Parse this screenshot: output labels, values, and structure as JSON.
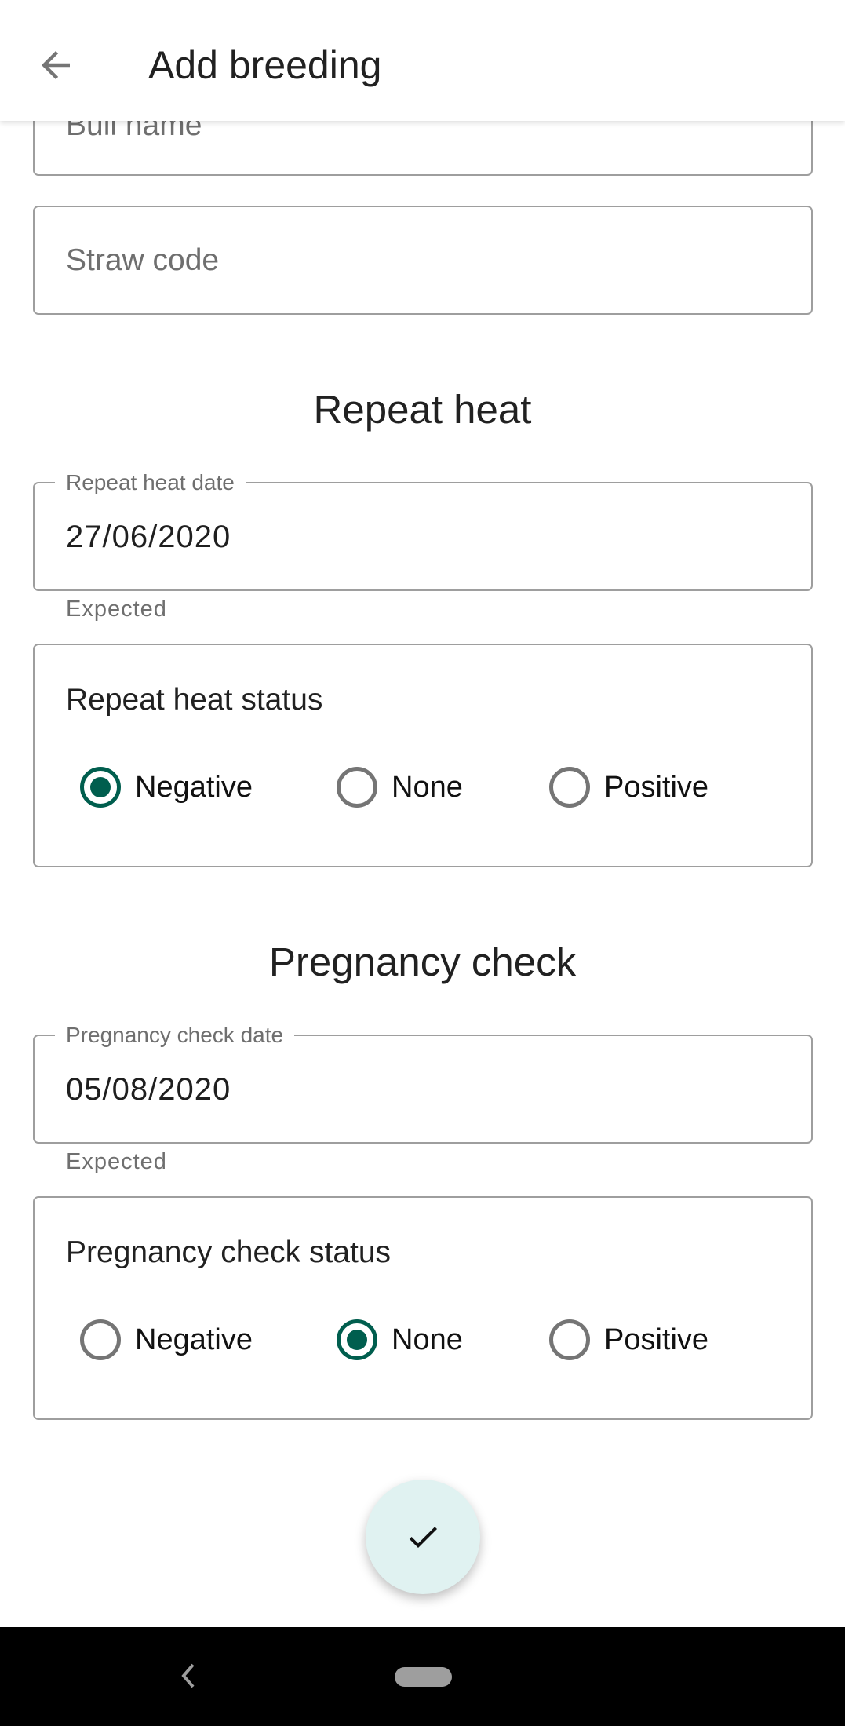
{
  "app_bar": {
    "title": "Add breeding",
    "back_icon": "arrow-back-icon"
  },
  "fields": {
    "bull_name": {
      "placeholder": "Bull name"
    },
    "straw_code": {
      "placeholder": "Straw code"
    }
  },
  "repeat_heat": {
    "heading": "Repeat heat",
    "date_label": "Repeat heat date",
    "date_value": "27/06/2020",
    "helper": "Expected",
    "status_title": "Repeat heat status",
    "options": [
      "Negative",
      "None",
      "Positive"
    ],
    "selected": "Negative"
  },
  "pregnancy_check": {
    "heading": "Pregnancy check",
    "date_label": "Pregnancy check date",
    "date_value": "05/08/2020",
    "helper": "Expected",
    "status_title": "Pregnancy check status",
    "options": [
      "Negative",
      "None",
      "Positive"
    ],
    "selected": "None"
  },
  "fab": {
    "icon": "check-icon"
  },
  "colors": {
    "accent": "#005e4e",
    "fab_bg": "#e0f2f1"
  }
}
